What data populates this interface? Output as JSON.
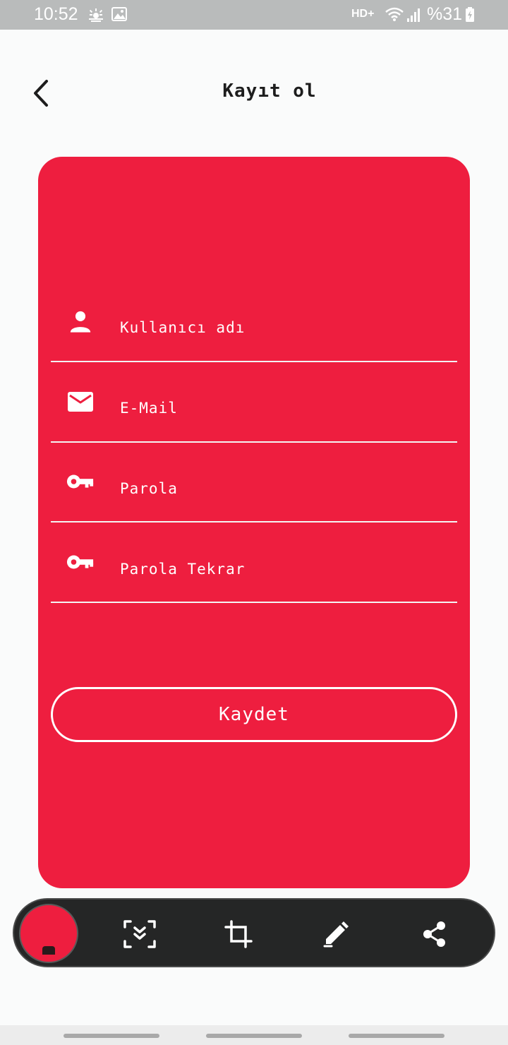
{
  "status_bar": {
    "time": "10:52",
    "network": "HD+",
    "battery": "%31",
    "icons": [
      "weather-icon",
      "gallery-icon",
      "wifi-icon",
      "signal-icon",
      "battery-charging-icon"
    ]
  },
  "header": {
    "back_icon": "chevron-left-icon",
    "title": "Kayıt ol"
  },
  "form": {
    "background_color": "#ee1e3f",
    "fields": [
      {
        "icon": "person-icon",
        "placeholder": "Kullanıcı adı"
      },
      {
        "icon": "mail-icon",
        "placeholder": "E-Mail"
      },
      {
        "icon": "key-icon",
        "placeholder": "Parola"
      },
      {
        "icon": "key-icon",
        "placeholder": "Parola Tekrar"
      }
    ],
    "save_label": "Kaydet"
  },
  "screenshot_toolbar": {
    "items": [
      "scroll-capture-icon",
      "crop-icon",
      "edit-pencil-icon",
      "share-icon"
    ]
  }
}
